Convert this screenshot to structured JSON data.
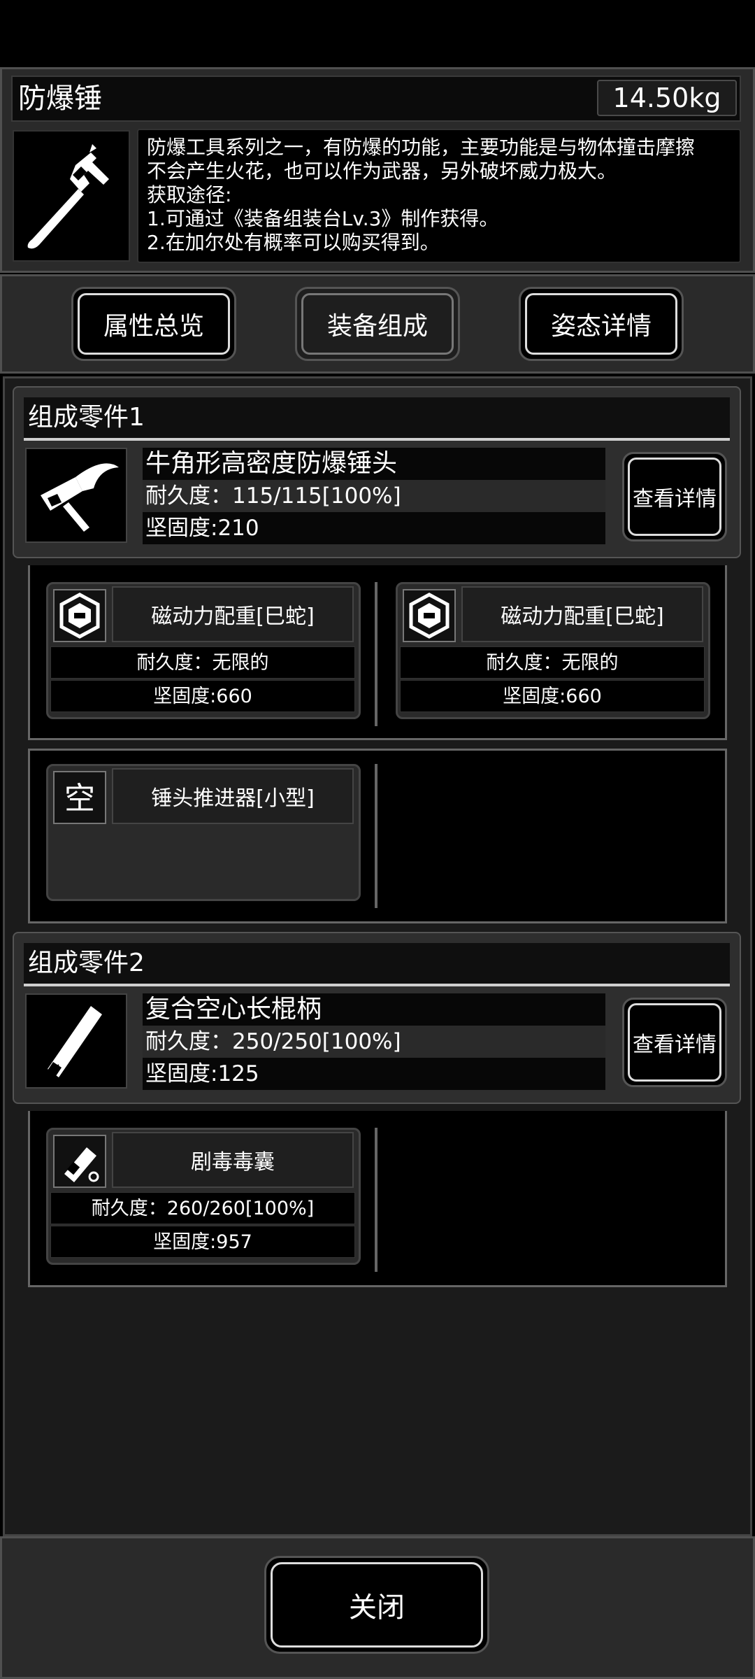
{
  "item": {
    "name": "防爆锤",
    "weight": "14.50kg",
    "icon": "hammer-icon",
    "description_lines": [
      "防爆工具系列之一，有防爆的功能，主要功能是与物体撞击摩擦",
      "不会产生火花，也可以作为武器，另外破坏威力极大。",
      "获取途径:",
      "1.可通过《装备组装台Lv.3》制作获得。",
      "2.在加尔处有概率可以购买得到。"
    ]
  },
  "tabs": [
    {
      "label": "属性总览",
      "active": false
    },
    {
      "label": "装备组成",
      "active": true
    },
    {
      "label": "姿态详情",
      "active": false
    }
  ],
  "parts": [
    {
      "title": "组成零件1",
      "name": "牛角形高密度防爆锤头",
      "durability": "耐久度：115/115[100%]",
      "firmness": "坚固度:210",
      "icon": "hammer-head-icon",
      "detail_label": "查看详情",
      "slots": [
        {
          "icon": "hexagon-magnet-icon",
          "name": "磁动力配重[巳蛇]",
          "durability": "耐久度：无限的",
          "firmness": "坚固度:660"
        },
        {
          "icon": "hexagon-magnet-icon",
          "name": "磁动力配重[巳蛇]",
          "durability": "耐久度：无限的",
          "firmness": "坚固度:660"
        },
        {
          "icon_text": "空",
          "name": "锤头推进器[小型]"
        }
      ]
    },
    {
      "title": "组成零件2",
      "name": "复合空心长棍柄",
      "durability": "耐久度：250/250[100%]",
      "firmness": "坚固度:125",
      "icon": "handle-icon",
      "detail_label": "查看详情",
      "slots": [
        {
          "icon": "poison-capsule-icon",
          "name": "剧毒毒囊",
          "durability": "耐久度：260/260[100%]",
          "firmness": "坚固度:957"
        }
      ]
    }
  ],
  "close_label": "关闭",
  "colors": {
    "background": "#000000",
    "panel": "#2a2a2a",
    "border": "#505050",
    "text": "#ffffff"
  }
}
